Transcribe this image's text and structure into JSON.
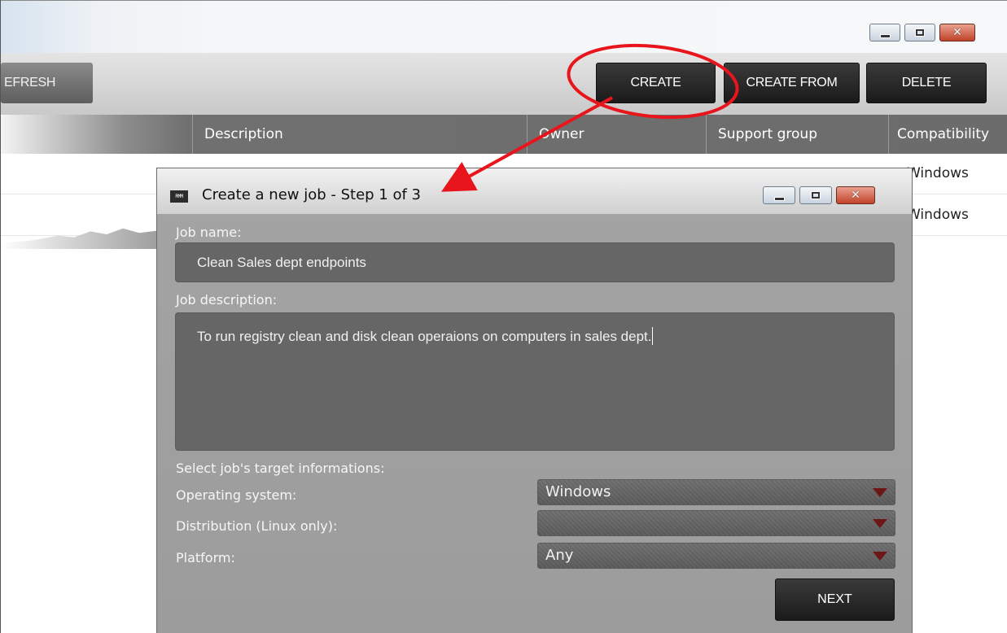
{
  "background_window": {
    "toolbar": {
      "refresh_label": "EFRESH",
      "create_label": "CREATE",
      "create_from_label": "CREATE FROM",
      "delete_label": "DELETE"
    },
    "columns": [
      "Description",
      "Owner",
      "Support group",
      "Compatibility"
    ],
    "rows": [
      {
        "compatibility": "Windows"
      },
      {
        "compatibility": "Windows"
      }
    ]
  },
  "dialog": {
    "title": "Create a new job - Step 1 of 3",
    "app_icon_text": "RMM",
    "job_name_label": "Job name:",
    "job_name_value": "Clean Sales dept endpoints",
    "job_description_label": "Job description:",
    "job_description_value": "To run registry clean and disk clean operaions on computers in sales dept.",
    "target_section_label": "Select job's target informations:",
    "os_label": "Operating system:",
    "os_value": "Windows",
    "distribution_label": "Distribution (Linux only):",
    "distribution_value": "",
    "platform_label": "Platform:",
    "platform_value": "Any",
    "next_label": "NEXT"
  },
  "colors": {
    "annotation_red": "#e8161c",
    "dropdown_arrow": "#6e1515"
  }
}
